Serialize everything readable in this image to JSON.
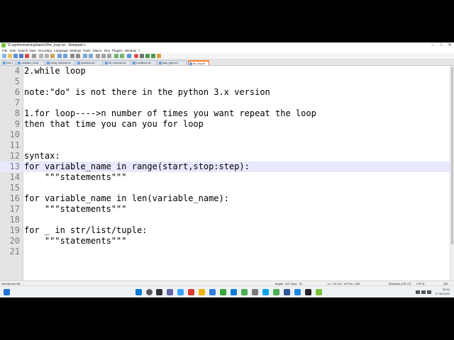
{
  "window": {
    "title": "*E:\\pythontraining\\batch2\\for_loop.txt - Notepad++",
    "minimize": "–",
    "maximize": "□",
    "close": "✕"
  },
  "menu": [
    "File",
    "Edit",
    "Search",
    "View",
    "Encoding",
    "Language",
    "Settings",
    "Tools",
    "Macro",
    "Run",
    "Plugins",
    "Window",
    "?"
  ],
  "tabs": [
    {
      "label": "new 1"
    },
    {
      "label": "variables_int.txt"
    },
    {
      "label": "string_methods.txt"
    },
    {
      "label": "operators.txt"
    },
    {
      "label": "list_methods.txt"
    },
    {
      "label": "conditions.txt"
    },
    {
      "label": "data_types.txt"
    },
    {
      "label": "for_loop.txt",
      "active": true
    }
  ],
  "editor": {
    "lines": [
      {
        "n": "4",
        "text": "2.while loop"
      },
      {
        "n": "5",
        "text": ""
      },
      {
        "n": "6",
        "text": "note:\"do\" is not there in the python 3.x version"
      },
      {
        "n": "7",
        "text": ""
      },
      {
        "n": "8",
        "text": "1.for loop---->n number of times you want repeat the loop"
      },
      {
        "n": "9",
        "text": "then that time you can you for loop"
      },
      {
        "n": "10",
        "text": ""
      },
      {
        "n": "11",
        "text": ""
      },
      {
        "n": "12",
        "text": "syntax:"
      },
      {
        "n": "13",
        "text": "for variable_name in range(start,stop:step):",
        "current": true
      },
      {
        "n": "14",
        "text": "    \"\"\"statements\"\"\""
      },
      {
        "n": "15",
        "text": ""
      },
      {
        "n": "16",
        "text": "for variable_name in len(variable_name):"
      },
      {
        "n": "17",
        "text": "    \"\"\"statements\"\"\""
      },
      {
        "n": "18",
        "text": ""
      },
      {
        "n": "19",
        "text": "for _ in str/list/tuple:"
      },
      {
        "n": "20",
        "text": "    \"\"\"statements\"\"\""
      },
      {
        "n": "21",
        "text": ""
      }
    ]
  },
  "status": {
    "filetype": "Normal text file",
    "length": "length : 407   lines : 21",
    "position": "Ln : 13    Col : 34    Pos : 263",
    "eol": "Windows (CR LF)",
    "encoding": "UTF-8",
    "mode": "INS"
  },
  "taskbar": {
    "time": "09:24",
    "date": "17-08-2022"
  },
  "colors": {
    "current_line": "#e8e8ff",
    "active_tab": "#ff7f27",
    "gutter": "#e4e4e4"
  }
}
